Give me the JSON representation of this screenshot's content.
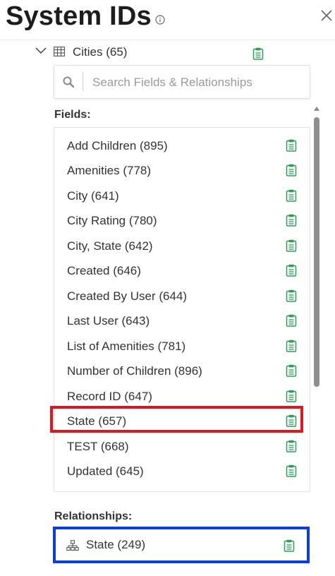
{
  "header": {
    "title": "System IDs"
  },
  "tree_node": {
    "label": "Cities (65)"
  },
  "search": {
    "placeholder": "Search Fields & Relationships"
  },
  "fields_section": {
    "label": "Fields:",
    "items": [
      {
        "label": "Add Children (895)"
      },
      {
        "label": "Amenities (778)"
      },
      {
        "label": "City (641)"
      },
      {
        "label": "City Rating (780)"
      },
      {
        "label": "City, State (642)"
      },
      {
        "label": "Created (646)"
      },
      {
        "label": "Created By User (644)"
      },
      {
        "label": "Last User (643)"
      },
      {
        "label": "List of Amenities (781)"
      },
      {
        "label": "Number of Children (896)"
      },
      {
        "label": "Record ID (647)"
      },
      {
        "label": "State (657)"
      },
      {
        "label": "TEST (668)"
      },
      {
        "label": "Updated (645)"
      }
    ]
  },
  "relationships_section": {
    "label": "Relationships:",
    "items": [
      {
        "label": "State (249)"
      }
    ]
  },
  "colors": {
    "accent": "#2e9d57",
    "highlight_red": "#e0161f",
    "highlight_blue": "#0a3ee0"
  }
}
